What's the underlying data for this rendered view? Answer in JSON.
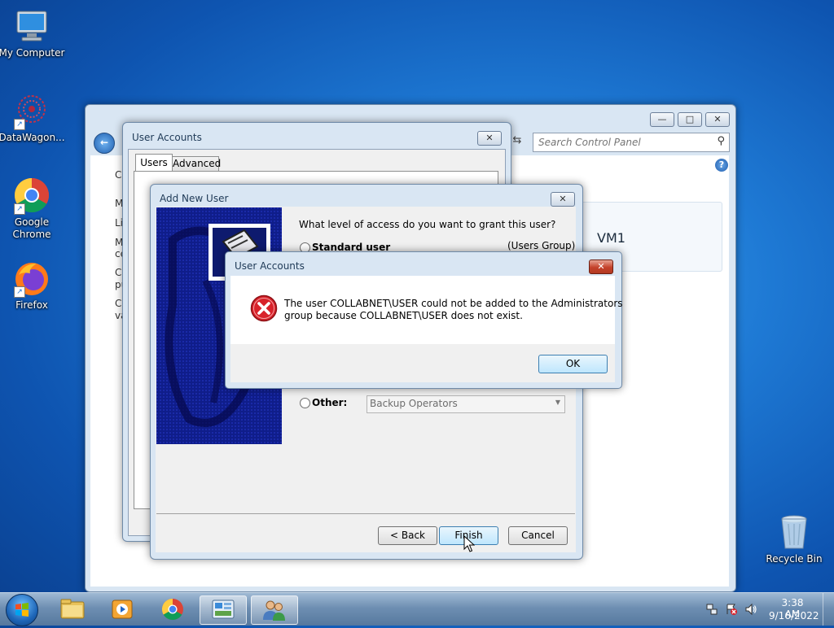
{
  "desktop": {
    "icons": [
      {
        "label": "My Computer"
      },
      {
        "label": "DataWagon..."
      },
      {
        "label": "Google Chrome"
      },
      {
        "label": "Firefox"
      },
      {
        "label": "Recycle Bin"
      }
    ]
  },
  "control_panel": {
    "search_placeholder": "Search Control Panel",
    "content_label": "VM1",
    "side_letters": [
      "C",
      "M",
      "Li",
      "M",
      "ce",
      "C",
      "pu",
      "C",
      "va"
    ]
  },
  "user_accounts_window": {
    "title": "User Accounts",
    "tabs": [
      {
        "label": "Users"
      },
      {
        "label": "Advanced"
      }
    ]
  },
  "add_new_user_window": {
    "title": "Add New User",
    "question": "What level of access do you want to grant this user?",
    "options": [
      {
        "label": "Standard user",
        "group": "(Users Group)"
      },
      {
        "label": "Other:",
        "select_value": "Backup Operators"
      }
    ],
    "buttons": {
      "back": "< Back",
      "finish": "Finish",
      "cancel": "Cancel"
    }
  },
  "error_dialog": {
    "title": "User Accounts",
    "message_line1": "The user COLLABNET\\USER could not be added to the Administrators",
    "message_line2": "group because COLLABNET\\USER does not exist.",
    "ok_label": "OK"
  },
  "taskbar": {
    "time": "3:38 AM",
    "date": "9/16/2022"
  }
}
